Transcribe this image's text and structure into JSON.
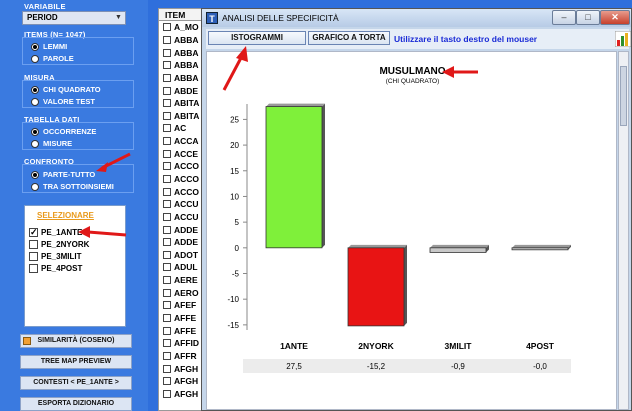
{
  "left_panel": {
    "variabile": {
      "label": "VARIABILE",
      "selected": "PERIOD"
    },
    "items": {
      "label": "ITEMS (N= 1047)",
      "options": [
        {
          "label": "LEMMI",
          "checked": true
        },
        {
          "label": "PAROLE",
          "checked": false
        }
      ]
    },
    "misura": {
      "label": "MISURA",
      "options": [
        {
          "label": "CHI QUADRATO",
          "checked": true
        },
        {
          "label": "VALORE TEST",
          "checked": false
        }
      ]
    },
    "tabella": {
      "label": "TABELLA DATI",
      "options": [
        {
          "label": "OCCORRENZE",
          "checked": true
        },
        {
          "label": "MISURE",
          "checked": false
        }
      ]
    },
    "confronto": {
      "label": "CONFRONTO",
      "options": [
        {
          "label": "PARTE-TUTTO",
          "checked": true
        },
        {
          "label": "TRA SOTTOINSIEMI",
          "checked": false
        }
      ]
    },
    "selezionare": {
      "title": "SELEZIONARE",
      "items": [
        {
          "label": "PE_1ANTE",
          "checked": true
        },
        {
          "label": "PE_2NYORK",
          "checked": false
        },
        {
          "label": "PE_3MILIT",
          "checked": false
        },
        {
          "label": "PE_4POST",
          "checked": false
        }
      ]
    },
    "buttons": {
      "similarita": "SIMILARITÀ (COSENO)",
      "tree_map": "TREE MAP PREVIEW",
      "contesti": "CONTESTI  < PE_1ANTE >",
      "esporta": "ESPORTA DIZIONARIO"
    }
  },
  "item_list": {
    "header": "ITEM",
    "rows": [
      "A_MO",
      "ABBA",
      "ABBA",
      "ABBA",
      "ABBA",
      "ABDE",
      "ABITA",
      "ABITA",
      "AC",
      "ACCA",
      "ACCE",
      "ACCO",
      "ACCO",
      "ACCO",
      "ACCU",
      "ACCU",
      "ADDE",
      "ADDE",
      "ADOT",
      "ADUL",
      "AERE",
      "AERO",
      "AFEF",
      "AFFE",
      "AFFE",
      "AFFID",
      "AFFR",
      "AFGH",
      "AFGH",
      "AFGH"
    ]
  },
  "window": {
    "title": "ANALISI DELLE SPECIFICITÀ",
    "icon_letter": "T",
    "controls": [
      "minimize-icon",
      "maximize-icon",
      "close-icon"
    ],
    "toolbar": {
      "istogrammi": "ISTOGRAMMI",
      "grafico_torta": "GRAFICO A TORTA",
      "hint": "Utilizzare il tasto destro del mouser"
    }
  },
  "chart_data": {
    "type": "bar",
    "title": "MUSULMANO",
    "subtitle": "(CHI QUADRATO)",
    "categories": [
      "1ANTE",
      "2NYORK",
      "3MILIT",
      "4POST"
    ],
    "values": [
      27.5,
      -15.2,
      -0.9,
      -0.0
    ],
    "value_labels": [
      "27,5",
      "-15,2",
      "-0,9",
      "-0,0"
    ],
    "colors": [
      "#7ff03a",
      "#e81414",
      "#c8c8c8",
      "#c8c8c8"
    ],
    "yticks": [
      -15,
      -10,
      -5,
      0,
      5,
      10,
      15,
      20,
      25
    ],
    "ylim": [
      -16,
      28
    ]
  },
  "colors": {
    "arrow": "#e01818",
    "accent": "#3a7ae0"
  }
}
